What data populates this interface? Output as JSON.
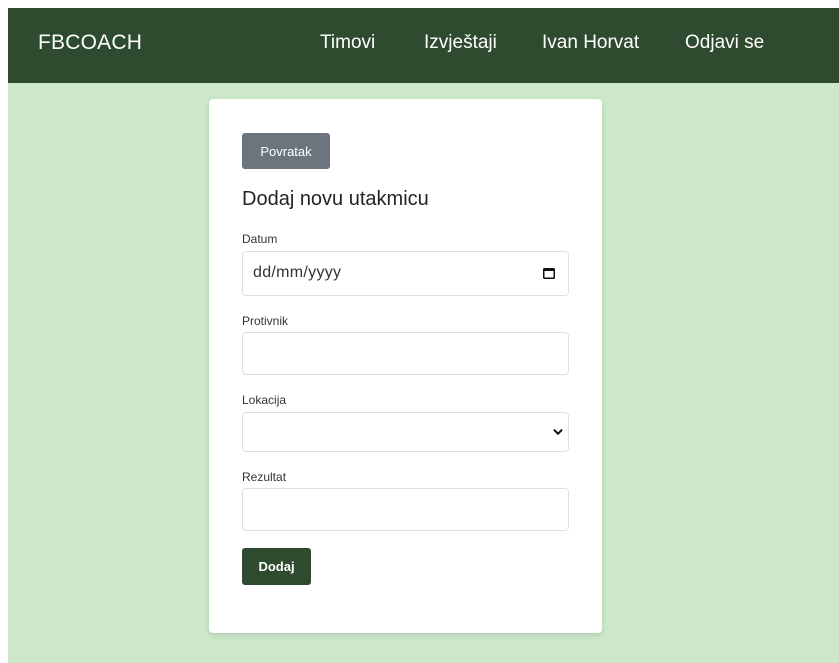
{
  "navbar": {
    "brand": "FBCOACH",
    "links": [
      {
        "label": "Timovi"
      },
      {
        "label": "Izvještaji"
      },
      {
        "label": "Ivan Horvat"
      },
      {
        "label": "Odjavi se"
      }
    ]
  },
  "form": {
    "back_label": "Povratak",
    "title": "Dodaj novu utakmicu",
    "fields": {
      "datum": {
        "label": "Datum",
        "value": "",
        "placeholder": "dd/mm/yyyy"
      },
      "protivnik": {
        "label": "Protivnik",
        "value": ""
      },
      "lokacija": {
        "label": "Lokacija",
        "selected": ""
      },
      "rezultat": {
        "label": "Rezultat",
        "value": ""
      }
    },
    "submit_label": "Dodaj"
  },
  "icons": {
    "datum": "calendar-icon",
    "lokacija": "chevron-down-icon"
  },
  "colors": {
    "navbar": "#2e4b2f",
    "page_background": "#cce7ca",
    "card_background": "#ffffff",
    "back_button": "#6c757d",
    "submit_button": "#2e4b2f"
  }
}
